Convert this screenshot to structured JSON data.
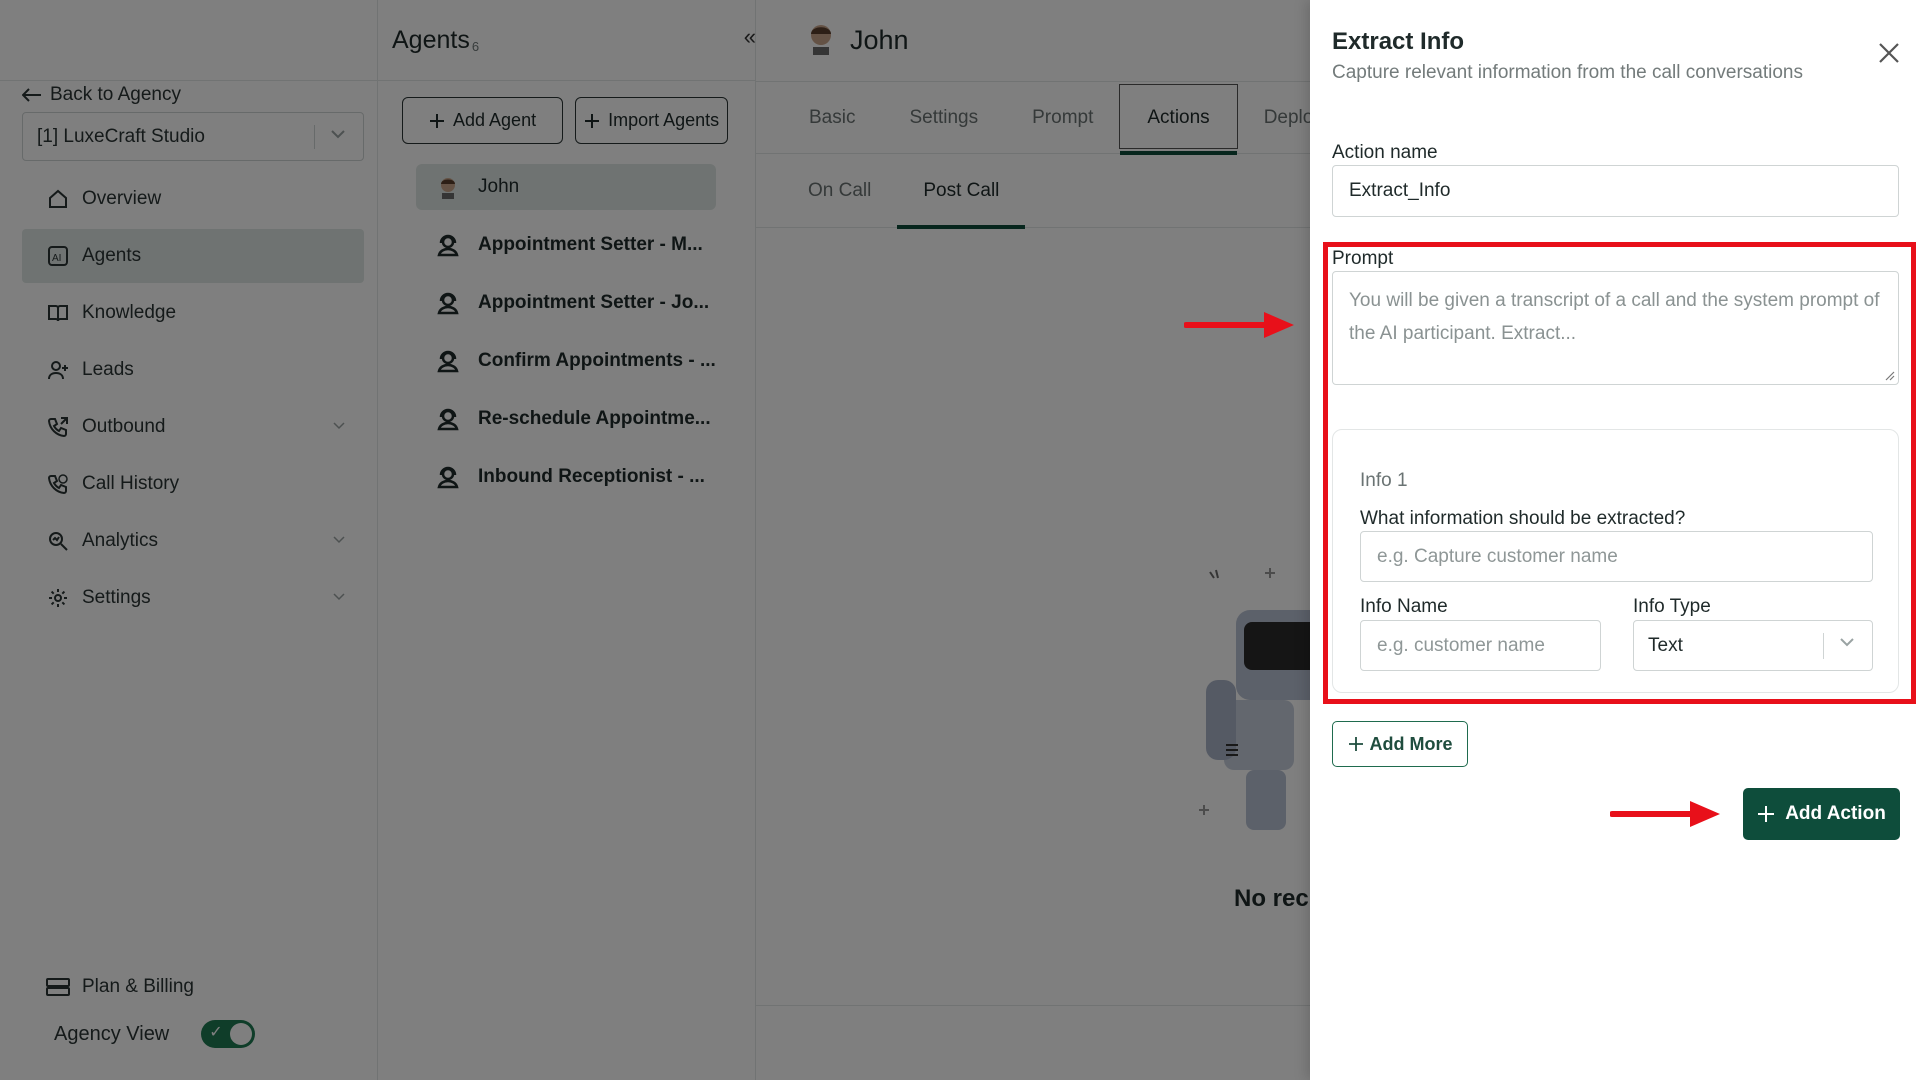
{
  "sidebar": {
    "back_label": "Back to Agency",
    "agency_selected": "[1] LuxeCraft Studio",
    "nav": [
      {
        "label": "Overview",
        "icon": "home-icon"
      },
      {
        "label": "Agents",
        "icon": "ai-icon"
      },
      {
        "label": "Knowledge",
        "icon": "book-icon"
      },
      {
        "label": "Leads",
        "icon": "user-plus-icon"
      },
      {
        "label": "Outbound",
        "icon": "phone-outgoing-icon"
      },
      {
        "label": "Call History",
        "icon": "phone-history-icon"
      },
      {
        "label": "Analytics",
        "icon": "analytics-icon"
      },
      {
        "label": "Settings",
        "icon": "gear-icon"
      }
    ],
    "billing_label": "Plan & Billing",
    "agency_view_label": "Agency View",
    "agency_view_on": true
  },
  "agents": {
    "title": "Agents",
    "count": "6",
    "add_label": "Add Agent",
    "import_label": "Import Agents",
    "items": [
      "John",
      "Appointment Setter - M...",
      "Appointment Setter - Jo...",
      "Confirm Appointments - ...",
      "Re-schedule Appointme...",
      "Inbound Receptionist - ..."
    ]
  },
  "main": {
    "agent_name": "John",
    "tabs": [
      "Basic",
      "Settings",
      "Prompt",
      "Actions",
      "Deploy"
    ],
    "active_tab": "Actions",
    "subtabs": [
      "On Call",
      "Post Call"
    ],
    "active_subtab": "Post Call",
    "empty_text": "No rec"
  },
  "drawer": {
    "title": "Extract Info",
    "subtitle": "Capture relevant information from the call conversations",
    "action_name_label": "Action name",
    "action_name_value": "Extract_Info",
    "prompt_label": "Prompt",
    "prompt_value": "You will be given a transcript of a call and the system prompt of the AI participant. Extract...",
    "info": {
      "title": "Info 1",
      "question_label": "What information should be extracted?",
      "question_placeholder": "e.g. Capture customer name",
      "name_label": "Info Name",
      "name_placeholder": "e.g. customer name",
      "type_label": "Info Type",
      "type_value": "Text"
    },
    "add_more_label": "Add More",
    "add_action_label": "Add Action"
  },
  "colors": {
    "accent": "#0e4d3b",
    "highlight": "#e8101a"
  }
}
